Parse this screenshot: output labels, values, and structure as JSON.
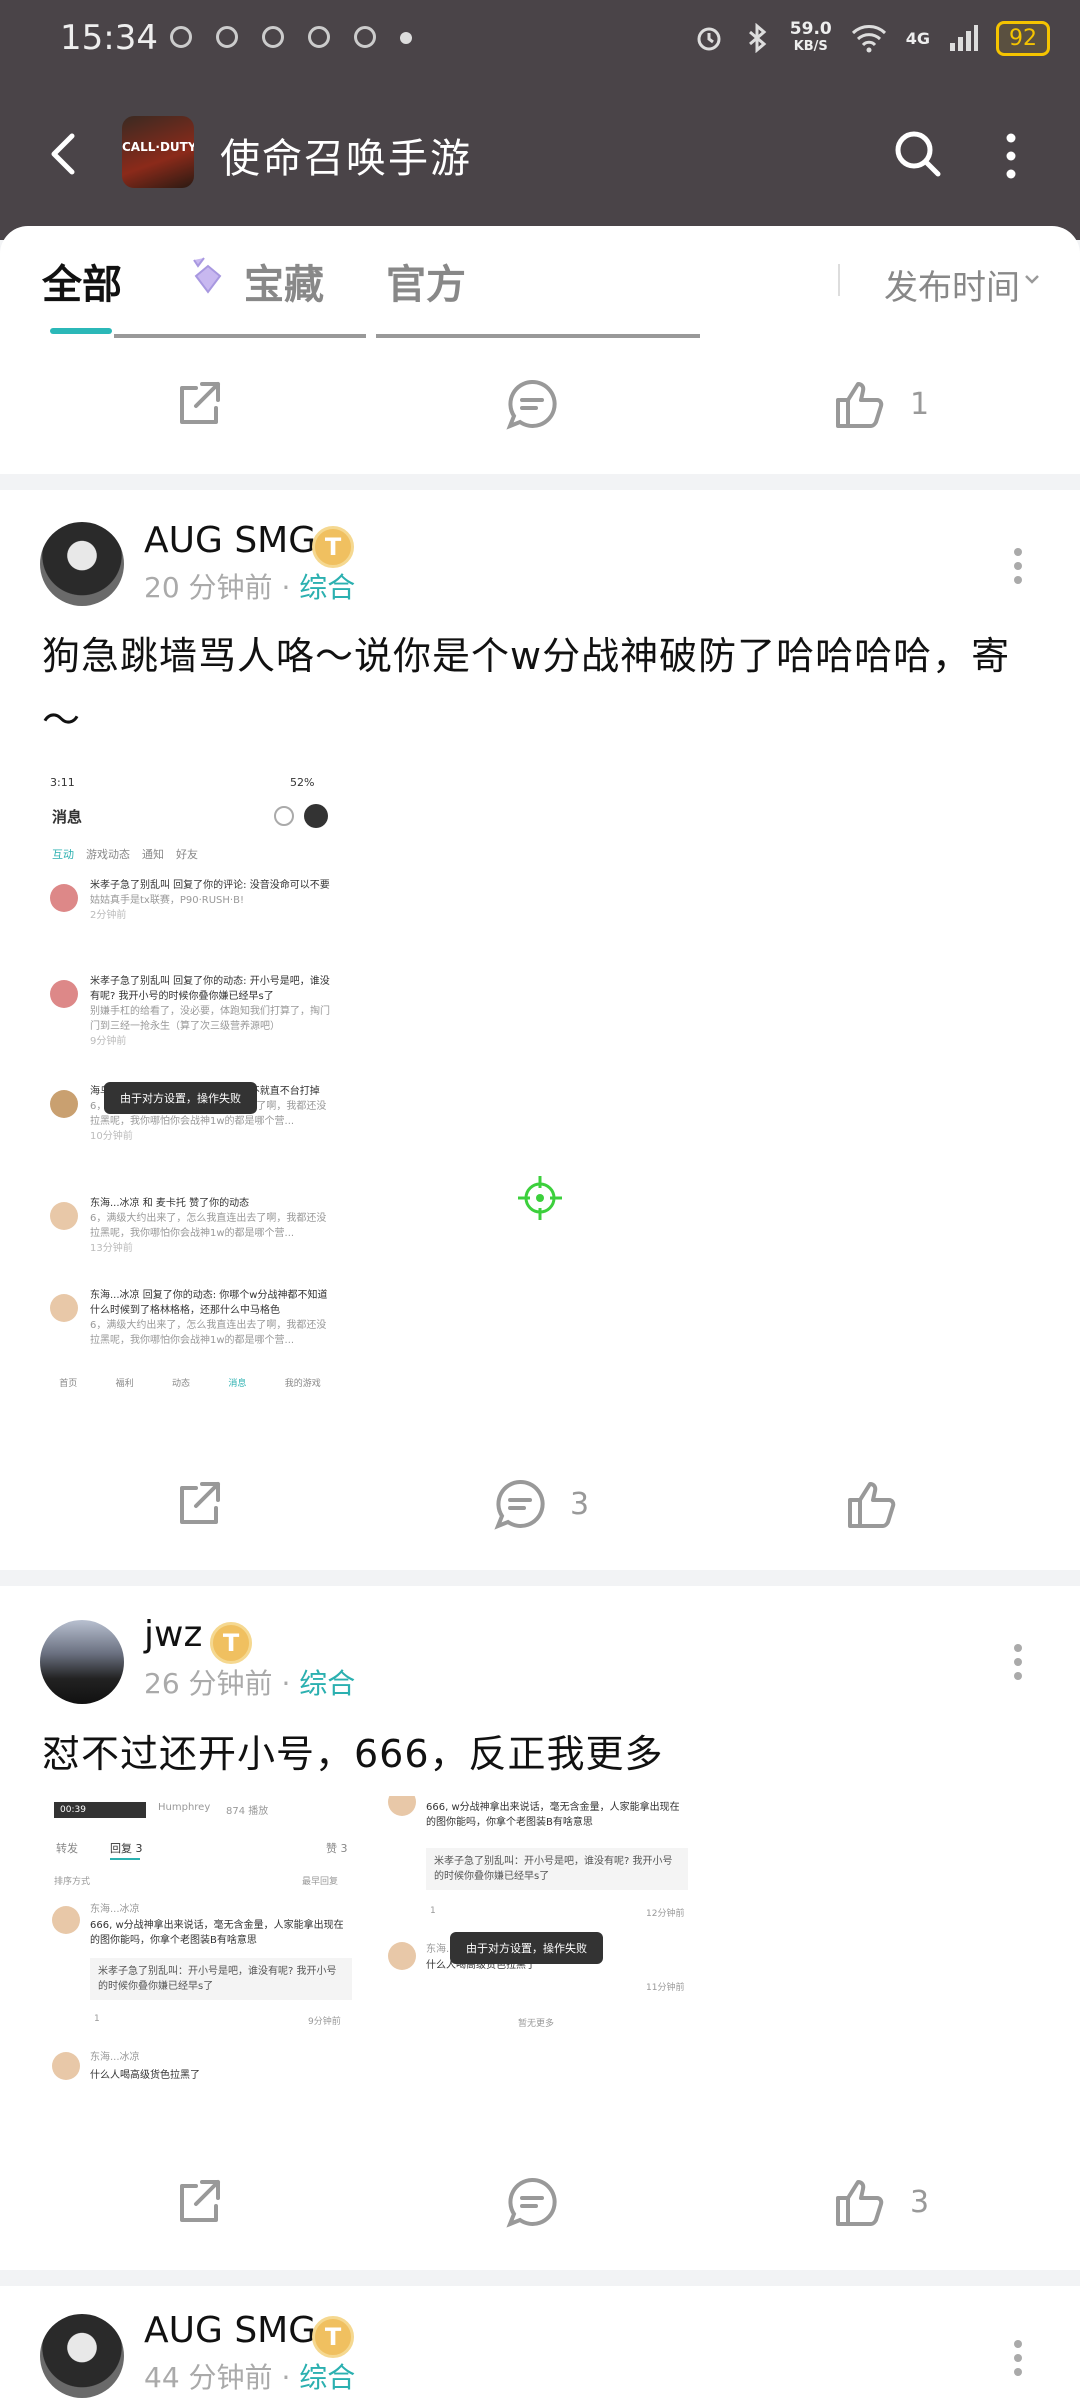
{
  "status_bar": {
    "time": "15:34",
    "net_speed": "59.0",
    "net_unit": "KB/S",
    "signal": "4G",
    "battery": "92"
  },
  "header": {
    "title": "使命召唤手游",
    "logo_text": "CALL·DUTY"
  },
  "tabs": {
    "items": [
      "全部",
      "宝藏",
      "官方"
    ],
    "sort_label": "发布时间"
  },
  "prev_post": {
    "like_count": "1"
  },
  "posts": [
    {
      "author": "AUG SMG",
      "badge": "T",
      "time": "20 分钟前",
      "dot": "·",
      "category": "综合",
      "text": "狗急跳墙骂人咯～说你是个w分战神破防了哈哈哈哈，寄～",
      "comment_count": "3",
      "screenshot": {
        "status_time": "3:11",
        "battery": "52%",
        "title": "消息",
        "tabs": [
          "互动",
          "游戏动态",
          "通知",
          "好友"
        ],
        "rows": [
          {
            "title": "米孝子急了别乱叫 回复了你的评论: 没音没命可以不要",
            "sub": "姑姑真手是tx联赛，P90·RUSH·B!",
            "time": "2分钟前"
          },
          {
            "title": "米孝子急了别乱叫 回复了你的动态: 开小号是吧，谁没有呢? 我开小号的时候你叠你嫌已经早s了",
            "sub": "别嫌手杠的给看了，没必要，体跑知我们打算了，掏门门到三经一抢永生（算了次三级营养源吧）",
            "time": "9分钟前"
          },
          {
            "title": "海鸟东海 回复了你的动态: 不开手，不就直不台打掉",
            "sub": "6，满级大约出来了，怎么我直连出去了啊，我都还没拉黑呢，我你哪怕你会战神1w的都是哪个营...",
            "time": "10分钟前"
          },
          {
            "title": "东海...冰凉 和 麦卡托 赞了你的动态",
            "sub": "6，满级大约出来了，怎么我直连出去了啊，我都还没拉黑呢，我你哪怕你会战神1w的都是哪个营...",
            "time": "13分钟前"
          },
          {
            "title": "东海...冰凉 回复了你的动态: 你哪个w分战神都不知道什么时候到了格林格格，还那什么中马格色",
            "sub": "6，满级大约出来了，怎么我直连出去了啊，我都还没拉黑呢，我你哪怕你会战神1w的都是哪个营...",
            "time": ""
          }
        ],
        "toast": "由于对方设置，操作失败",
        "nav": [
          "首页",
          "福利",
          "动态",
          "消息",
          "我的游戏"
        ]
      }
    },
    {
      "author": "jwz",
      "badge": "T",
      "time": "26 分钟前",
      "dot": "·",
      "category": "综合",
      "text": "怼不过还开小号，666，反正我更多",
      "like_count": "3",
      "screenshot_left": {
        "chip_time": "00:39",
        "chip_user": "Humphrey",
        "chip_views": "874 播放",
        "tabs": [
          "转发",
          "回复 3",
          "赞 3"
        ],
        "sort_left": "排序方式",
        "sort_right": "最早回复",
        "c1_name": "东海...冰凉",
        "c1_text": "666, w分战神拿出来说话，毫无含金量，人家能拿出现在的图你能吗，你拿个老图装B有啥意思",
        "quote": "米孝子急了别乱叫：开小号是吧，谁没有呢? 我开小号的时候你叠你嫌已经早s了",
        "c1_replies": "1",
        "c1_time": "9分钟前",
        "c2_name": "东海...冰凉",
        "c2_text": "什么人喝高级货色拉黑了"
      },
      "screenshot_right": {
        "c1_text": "666, w分战神拿出来说话，毫无含金量，人家能拿出现在的图你能吗，你拿个老图装B有啥意思",
        "quote": "米孝子急了别乱叫：开小号是吧，谁没有呢? 我开小号的时候你叠你嫌已经早s了",
        "c1_replies": "1",
        "c1_time": "12分钟前",
        "c2_name": "东海...",
        "c2_text": "什么人喝高级货色拉黑了",
        "c2_time": "11分钟前",
        "toast": "由于对方设置，操作失败",
        "more": "暂无更多"
      }
    },
    {
      "author": "AUG SMG",
      "badge": "T",
      "time": "44 分钟前",
      "dot": "·",
      "category": "综合"
    }
  ]
}
